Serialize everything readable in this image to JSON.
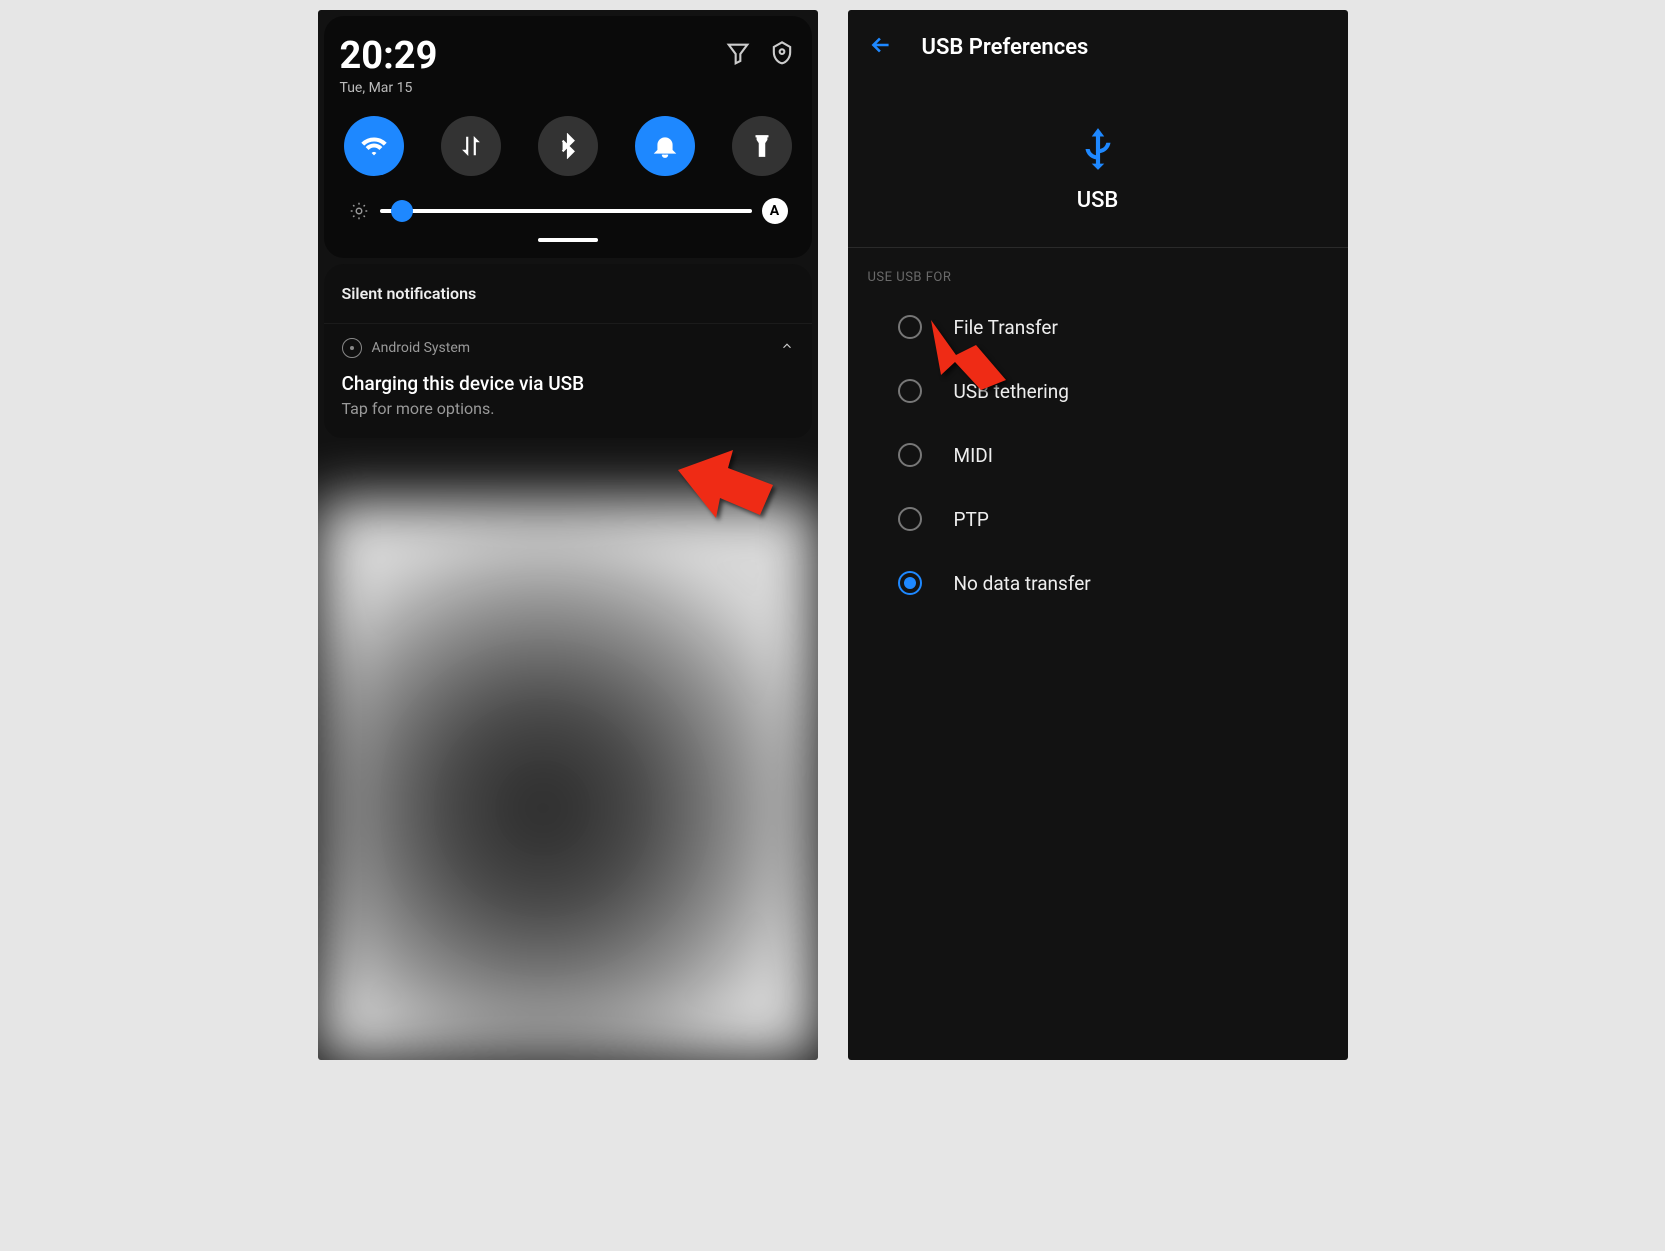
{
  "left": {
    "time": "20:29",
    "date": "Tue, Mar 15",
    "toggles": [
      {
        "name": "wifi",
        "active": true
      },
      {
        "name": "data",
        "active": false
      },
      {
        "name": "bluetooth",
        "active": false
      },
      {
        "name": "bell",
        "active": true
      },
      {
        "name": "flashlight",
        "active": false
      }
    ],
    "brightness_auto": "A",
    "silent_header": "Silent notifications",
    "notification": {
      "app": "Android System",
      "title": "Charging this device via USB",
      "subtitle": "Tap for more options."
    }
  },
  "right": {
    "title": "USB Preferences",
    "usb_label": "USB",
    "section_label": "USE USB FOR",
    "options": [
      {
        "label": "File Transfer",
        "selected": false
      },
      {
        "label": "USB tethering",
        "selected": false
      },
      {
        "label": "MIDI",
        "selected": false
      },
      {
        "label": "PTP",
        "selected": false
      },
      {
        "label": "No data transfer",
        "selected": true
      }
    ]
  }
}
